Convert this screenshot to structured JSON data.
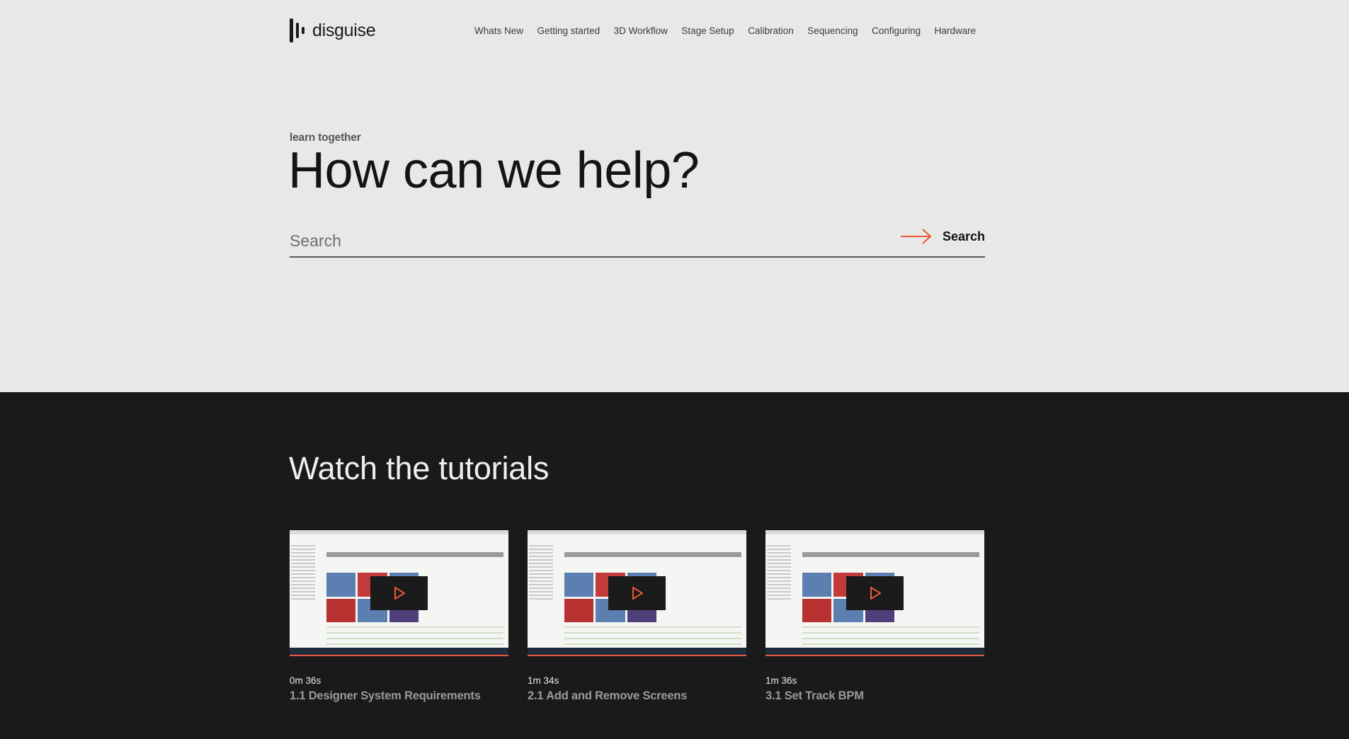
{
  "header": {
    "brand": "disguise",
    "nav": [
      "Whats New",
      "Getting started",
      "3D Workflow",
      "Stage Setup",
      "Calibration",
      "Sequencing",
      "Configuring",
      "Hardware"
    ]
  },
  "hero": {
    "eyebrow": "learn together",
    "title": "How can we help?",
    "search_placeholder": "Search",
    "search_button": "Search"
  },
  "tutorials": {
    "title": "Watch the tutorials",
    "items": [
      {
        "duration": "0m 36s",
        "title": "1.1 Designer System Requirements"
      },
      {
        "duration": "1m 34s",
        "title": "2.1 Add and Remove Screens"
      },
      {
        "duration": "1m 36s",
        "title": "3.1 Set Track BPM"
      }
    ]
  },
  "colors": {
    "accent": "#e8583a",
    "light_bg": "#e8e8e6",
    "dark_bg": "#1a1a1a"
  },
  "icons": {
    "logo": "disguise-logo-icon",
    "search_arrow": "arrow-right-icon",
    "video": "play-icon"
  }
}
